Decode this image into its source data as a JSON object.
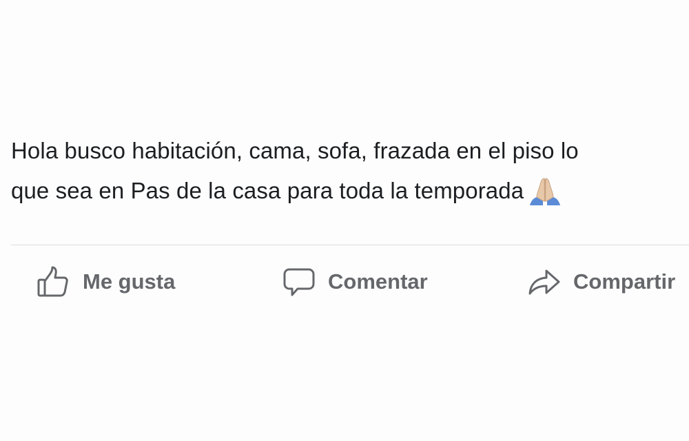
{
  "post": {
    "text_lines": [
      "Hola busco habitación, cama, sofa, frazada en el piso lo",
      "que sea en Pas de la casa para toda la temporada"
    ],
    "emoji": "folded-hands-icon"
  },
  "actions": {
    "like_label": "Me gusta",
    "comment_label": "Comentar",
    "share_label": "Compartir"
  },
  "colors": {
    "text": "#1c1e21",
    "action_gray": "#65676b",
    "divider": "#dadde1",
    "background": "#fdfdfd",
    "emoji_sleeve": "#5b8bd6",
    "emoji_skin": "#e7c8a8"
  }
}
